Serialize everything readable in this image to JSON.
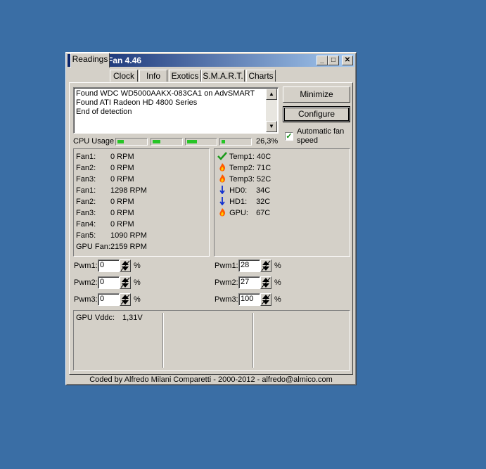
{
  "window": {
    "title": "SpeedFan 4.46"
  },
  "tabs": [
    "Readings",
    "Clock",
    "Info",
    "Exotics",
    "S.M.A.R.T.",
    "Charts"
  ],
  "log": {
    "lines": [
      "Found WDC WD5000AAKX-083CA1 on AdvSMART",
      "Found ATI Radeon HD 4800 Series",
      "End of detection"
    ]
  },
  "buttons": {
    "minimize": "Minimize",
    "configure": "Configure"
  },
  "auto_fan": {
    "label_line1": "Automatic fan",
    "label_line2": "speed",
    "checked": true
  },
  "cpu": {
    "label": "CPU Usage",
    "value": "26,3%",
    "bars": [
      0.18,
      0.22,
      0.28,
      0.1
    ]
  },
  "fans": [
    {
      "name": "Fan1:",
      "value": "0 RPM"
    },
    {
      "name": "Fan2:",
      "value": "0 RPM"
    },
    {
      "name": "Fan3:",
      "value": "0 RPM"
    },
    {
      "name": "Fan1:",
      "value": "1298 RPM"
    },
    {
      "name": "Fan2:",
      "value": "0 RPM"
    },
    {
      "name": "Fan3:",
      "value": "0 RPM"
    },
    {
      "name": "Fan4:",
      "value": "0 RPM"
    },
    {
      "name": "Fan5:",
      "value": "1090 RPM"
    },
    {
      "name": "GPU Fan:",
      "value": "2159 RPM"
    }
  ],
  "temps": [
    {
      "icon": "check-icon",
      "name": "Temp1:",
      "value": "40C"
    },
    {
      "icon": "flame-icon",
      "name": "Temp2:",
      "value": "71C"
    },
    {
      "icon": "flame-icon",
      "name": "Temp3:",
      "value": "52C"
    },
    {
      "icon": "arrow-down-icon",
      "name": "HD0:",
      "value": "34C"
    },
    {
      "icon": "arrow-down-icon",
      "name": "HD1:",
      "value": "32C"
    },
    {
      "icon": "flame-icon",
      "name": "GPU:",
      "value": "67C"
    }
  ],
  "pwm_left": [
    {
      "label": "Pwm1:",
      "value": "0",
      "unit": "%"
    },
    {
      "label": "Pwm2:",
      "value": "0",
      "unit": "%"
    },
    {
      "label": "Pwm3:",
      "value": "0",
      "unit": "%"
    }
  ],
  "pwm_right": [
    {
      "label": "Pwm1:",
      "value": "28",
      "unit": "%"
    },
    {
      "label": "Pwm2:",
      "value": "27",
      "unit": "%"
    },
    {
      "label": "Pwm3:",
      "value": "100",
      "unit": "%"
    }
  ],
  "voltages": {
    "gpu_vddc_label": "GPU Vddc:",
    "gpu_vddc_value": "1,31V"
  },
  "footer": "Coded by Alfredo Milani Comparetti - 2000-2012 - alfredo@almico.com"
}
